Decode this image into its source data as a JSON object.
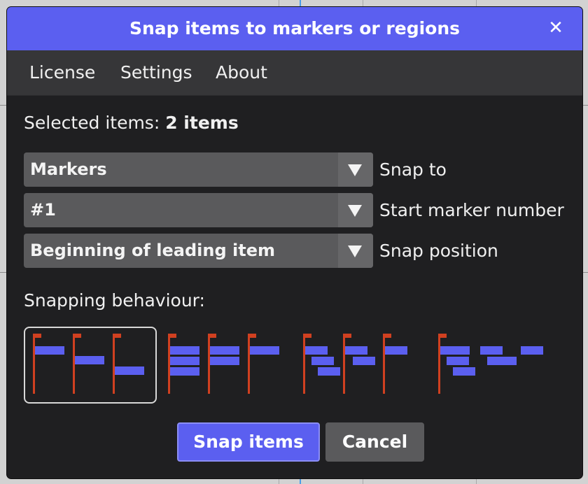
{
  "dialog": {
    "title": "Snap items to markers or regions",
    "close_icon": "close-icon"
  },
  "menu": {
    "items": [
      {
        "label": "License"
      },
      {
        "label": "Settings"
      },
      {
        "label": "About"
      }
    ]
  },
  "selection": {
    "prefix": "Selected items: ",
    "count": "2 items"
  },
  "fields": [
    {
      "value": "Markers",
      "label": "Snap to",
      "icon": "chevron-down-icon"
    },
    {
      "value": "#1",
      "label": "Start marker number",
      "icon": "chevron-down-icon"
    },
    {
      "value": "Beginning of leading item",
      "label": "Snap position",
      "icon": "chevron-down-icon"
    }
  ],
  "behaviour": {
    "label": "Snapping behaviour:",
    "options": [
      {
        "name": "staircase",
        "selected": true
      },
      {
        "name": "stacked-per-marker",
        "selected": false
      },
      {
        "name": "cascade-per-marker",
        "selected": false
      },
      {
        "name": "cascade-single-marker",
        "selected": false
      }
    ]
  },
  "buttons": {
    "primary": "Snap items",
    "secondary": "Cancel"
  },
  "colors": {
    "accent": "#5b5ff0",
    "marker": "#d04020",
    "dialog_bg": "#1f1f21",
    "menubar_bg": "#363638",
    "dropdown_bg": "#5a5a5c"
  }
}
